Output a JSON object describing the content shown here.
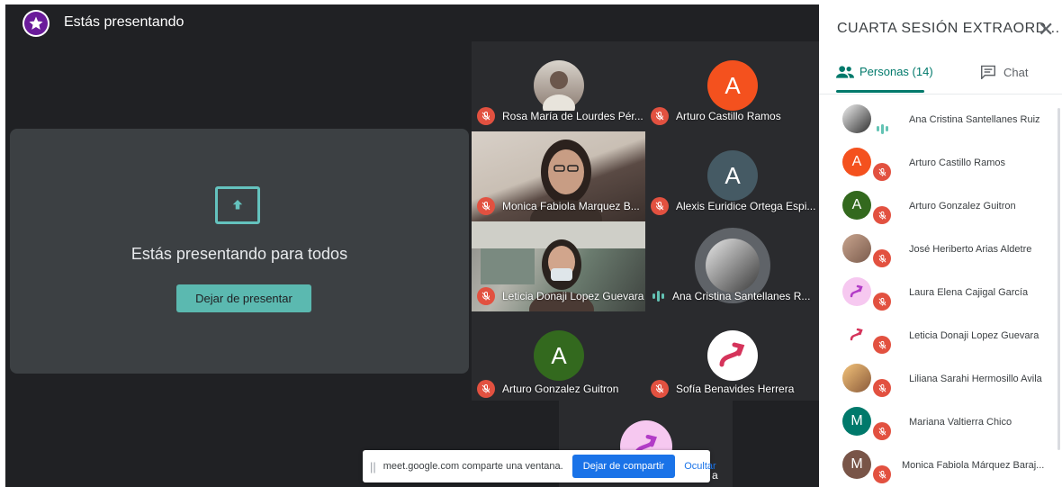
{
  "topbar": {
    "title": "Estás presentando"
  },
  "present_card": {
    "message": "Estás presentando para todos",
    "stop_button": "Dejar de presentar"
  },
  "tiles": [
    {
      "name": "Rosa María de Lourdes Pér...",
      "state": "muted",
      "kind": "avatar-photo"
    },
    {
      "name": "Arturo Castillo Ramos",
      "state": "muted",
      "kind": "letter",
      "letter": "A",
      "color": "#f4511e"
    },
    {
      "name": "Monica Fabiola Marquez B...",
      "state": "muted",
      "kind": "video"
    },
    {
      "name": "Alexis Euridice Ortega Espi...",
      "state": "muted",
      "kind": "letter",
      "letter": "A",
      "color": "#455a64"
    },
    {
      "name": "Leticia Donaji Lopez Guevara",
      "state": "muted",
      "kind": "video"
    },
    {
      "name": "Ana Cristina Santellanes R...",
      "state": "speaking",
      "kind": "avatar-photo"
    },
    {
      "name": "Arturo Gonzalez Guitron",
      "state": "muted",
      "kind": "letter",
      "letter": "A",
      "color": "#33691e"
    },
    {
      "name": "Sofía Benavides Herrera",
      "state": "muted",
      "kind": "logo"
    }
  ],
  "extra_tile": {
    "name_fragment": "a"
  },
  "share_banner": {
    "text": "meet.google.com comparte una ventana.",
    "stop_label": "Dejar de compartir",
    "hide_label": "Ocultar"
  },
  "panel": {
    "title": "CUARTA SESIÓN EXTRAORD...",
    "tabs": {
      "people": "Personas (14)",
      "chat": "Chat"
    },
    "participants": [
      {
        "name": "Ana Cristina Santellanes Ruiz",
        "kind": "photo",
        "state": "speaking"
      },
      {
        "name": "Arturo Castillo Ramos",
        "kind": "letter",
        "letter": "A",
        "color": "#f4511e",
        "state": "muted"
      },
      {
        "name": "Arturo Gonzalez Guitron",
        "kind": "letter",
        "letter": "A",
        "color": "#33691e",
        "state": "muted"
      },
      {
        "name": "José Heriberto Arias Aldetre",
        "kind": "photo",
        "state": "muted"
      },
      {
        "name": "Laura Elena Cajigal García",
        "kind": "logo",
        "state": "muted"
      },
      {
        "name": "Leticia Donaji Lopez Guevara",
        "kind": "logo",
        "state": "muted"
      },
      {
        "name": "Liliana Sarahi Hermosillo Avila",
        "kind": "photo",
        "state": "muted"
      },
      {
        "name": "Mariana Valtierra Chico",
        "kind": "letter",
        "letter": "M",
        "color": "#00796b",
        "state": "muted"
      },
      {
        "name": "Monica Fabiola Márquez Baraj...",
        "kind": "letter",
        "letter": "M",
        "color": "#795548",
        "state": "muted"
      }
    ]
  },
  "colors": {
    "accent": "#00796b",
    "mute_red": "#e25140",
    "stop_teal": "#5bb9b0",
    "banner_blue": "#1a73e8"
  }
}
